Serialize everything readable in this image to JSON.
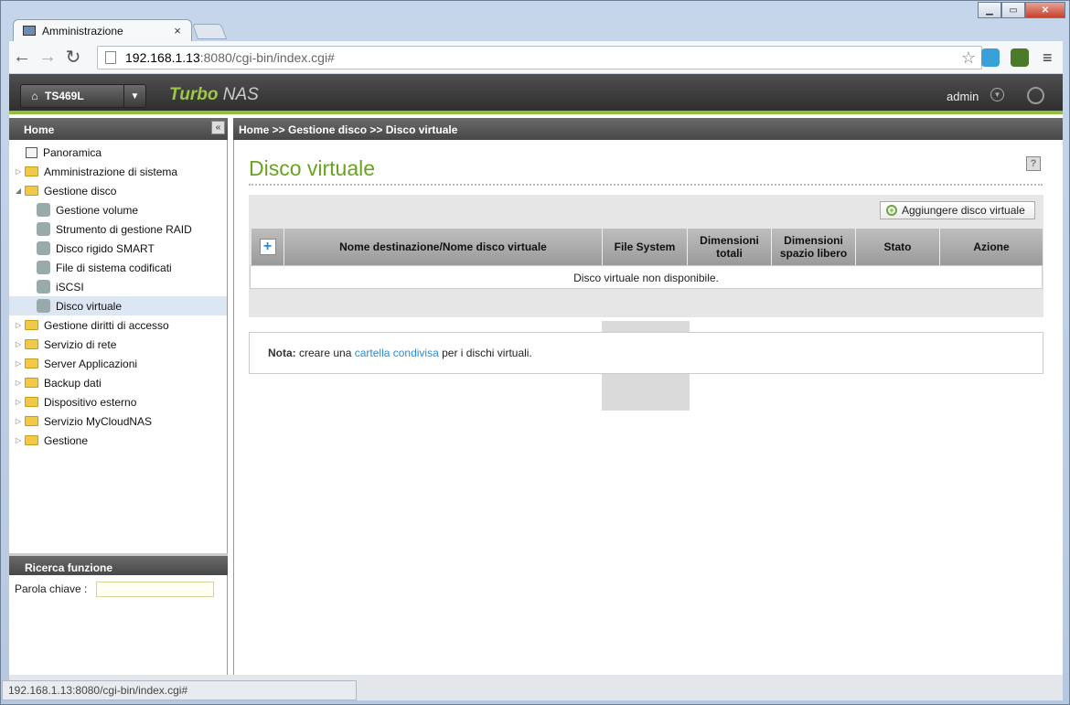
{
  "browser": {
    "tab_title": "Amministrazione",
    "tab_close": "×",
    "url_host": "192.168.1.13",
    "url_rest": ":8080/cgi-bin/index.cgi#",
    "status_url": "192.168.1.13:8080/cgi-bin/index.cgi#"
  },
  "header": {
    "device": "TS469L",
    "brand_1": "Turbo",
    "brand_2": " NAS",
    "user": "admin"
  },
  "sidebar": {
    "title": "Home",
    "items": [
      {
        "label": "Panoramica"
      },
      {
        "label": "Amministrazione di sistema"
      },
      {
        "label": "Gestione disco"
      },
      {
        "label": "Gestione volume"
      },
      {
        "label": "Strumento di gestione RAID"
      },
      {
        "label": "Disco rigido SMART"
      },
      {
        "label": "File di sistema codificati"
      },
      {
        "label": "iSCSI"
      },
      {
        "label": "Disco virtuale"
      },
      {
        "label": "Gestione diritti di accesso"
      },
      {
        "label": "Servizio di rete"
      },
      {
        "label": "Server Applicazioni"
      },
      {
        "label": "Backup dati"
      },
      {
        "label": "Dispositivo esterno"
      },
      {
        "label": "Servizio MyCloudNAS"
      },
      {
        "label": "Gestione"
      }
    ],
    "search_title": "Ricerca funzione",
    "keyword_label": "Parola chiave :"
  },
  "breadcrumb": "Home >> Gestione disco >> Disco virtuale",
  "main": {
    "title": "Disco virtuale",
    "add_button": "Aggiungere disco virtuale",
    "columns": [
      "Nome destinazione/Nome disco virtuale",
      "File System",
      "Dimensioni totali",
      "Dimensioni spazio libero",
      "Stato",
      "Azione"
    ],
    "empty_message": "Disco virtuale non disponibile.",
    "note_label": "Nota:",
    "note_text_1": " creare una ",
    "note_link": "cartella condivisa",
    "note_text_2": " per i dischi virtuali."
  }
}
